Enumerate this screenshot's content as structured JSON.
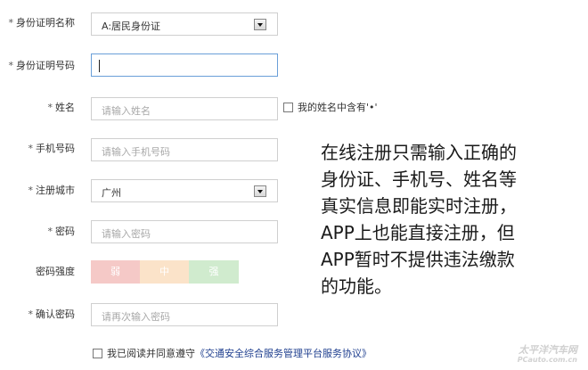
{
  "form": {
    "id_type": {
      "label": "身份证明名称",
      "required_mark": "*",
      "value": "A:居民身份证"
    },
    "id_number": {
      "label": "身份证明号码",
      "required_mark": "*",
      "value": ""
    },
    "name": {
      "label": "姓名",
      "required_mark": "*",
      "placeholder": "请输入姓名",
      "dot_checkbox_label": "我的姓名中含有'•'",
      "dot_checked": false
    },
    "phone": {
      "label": "手机号码",
      "required_mark": "*",
      "placeholder": "请输入手机号码"
    },
    "city": {
      "label": "注册城市",
      "required_mark": "*",
      "value": "广州"
    },
    "password": {
      "label": "密码",
      "required_mark": "*",
      "placeholder": "请输入密码"
    },
    "strength": {
      "label": "密码强度",
      "levels": [
        {
          "text": "弱",
          "color": "#f5c9c7"
        },
        {
          "text": "中",
          "color": "#fbe3c9"
        },
        {
          "text": "强",
          "color": "#d0ebce"
        }
      ]
    },
    "confirm": {
      "label": "确认密码",
      "required_mark": "*",
      "placeholder": "请再次输入密码"
    },
    "agreement": {
      "prefix": "我已阅读并同意遵守",
      "link": "《交通安全综合服务管理平台服务协议》",
      "checked": false
    }
  },
  "overlay_lines": [
    "在线注册只需输入正确的",
    "身份证、手机号、姓名等",
    "真实信息即能实时注册，",
    "APP上也能直接注册，但",
    "APP暂时不提供违法缴款",
    "的功能。"
  ],
  "watermark": {
    "line1": "太平洋汽车网",
    "line2": "PCauto.com.cn"
  },
  "colors": {
    "focus_border": "#6a9fd8",
    "link": "#1f3f8f",
    "field_border": "#cfcfcf"
  }
}
